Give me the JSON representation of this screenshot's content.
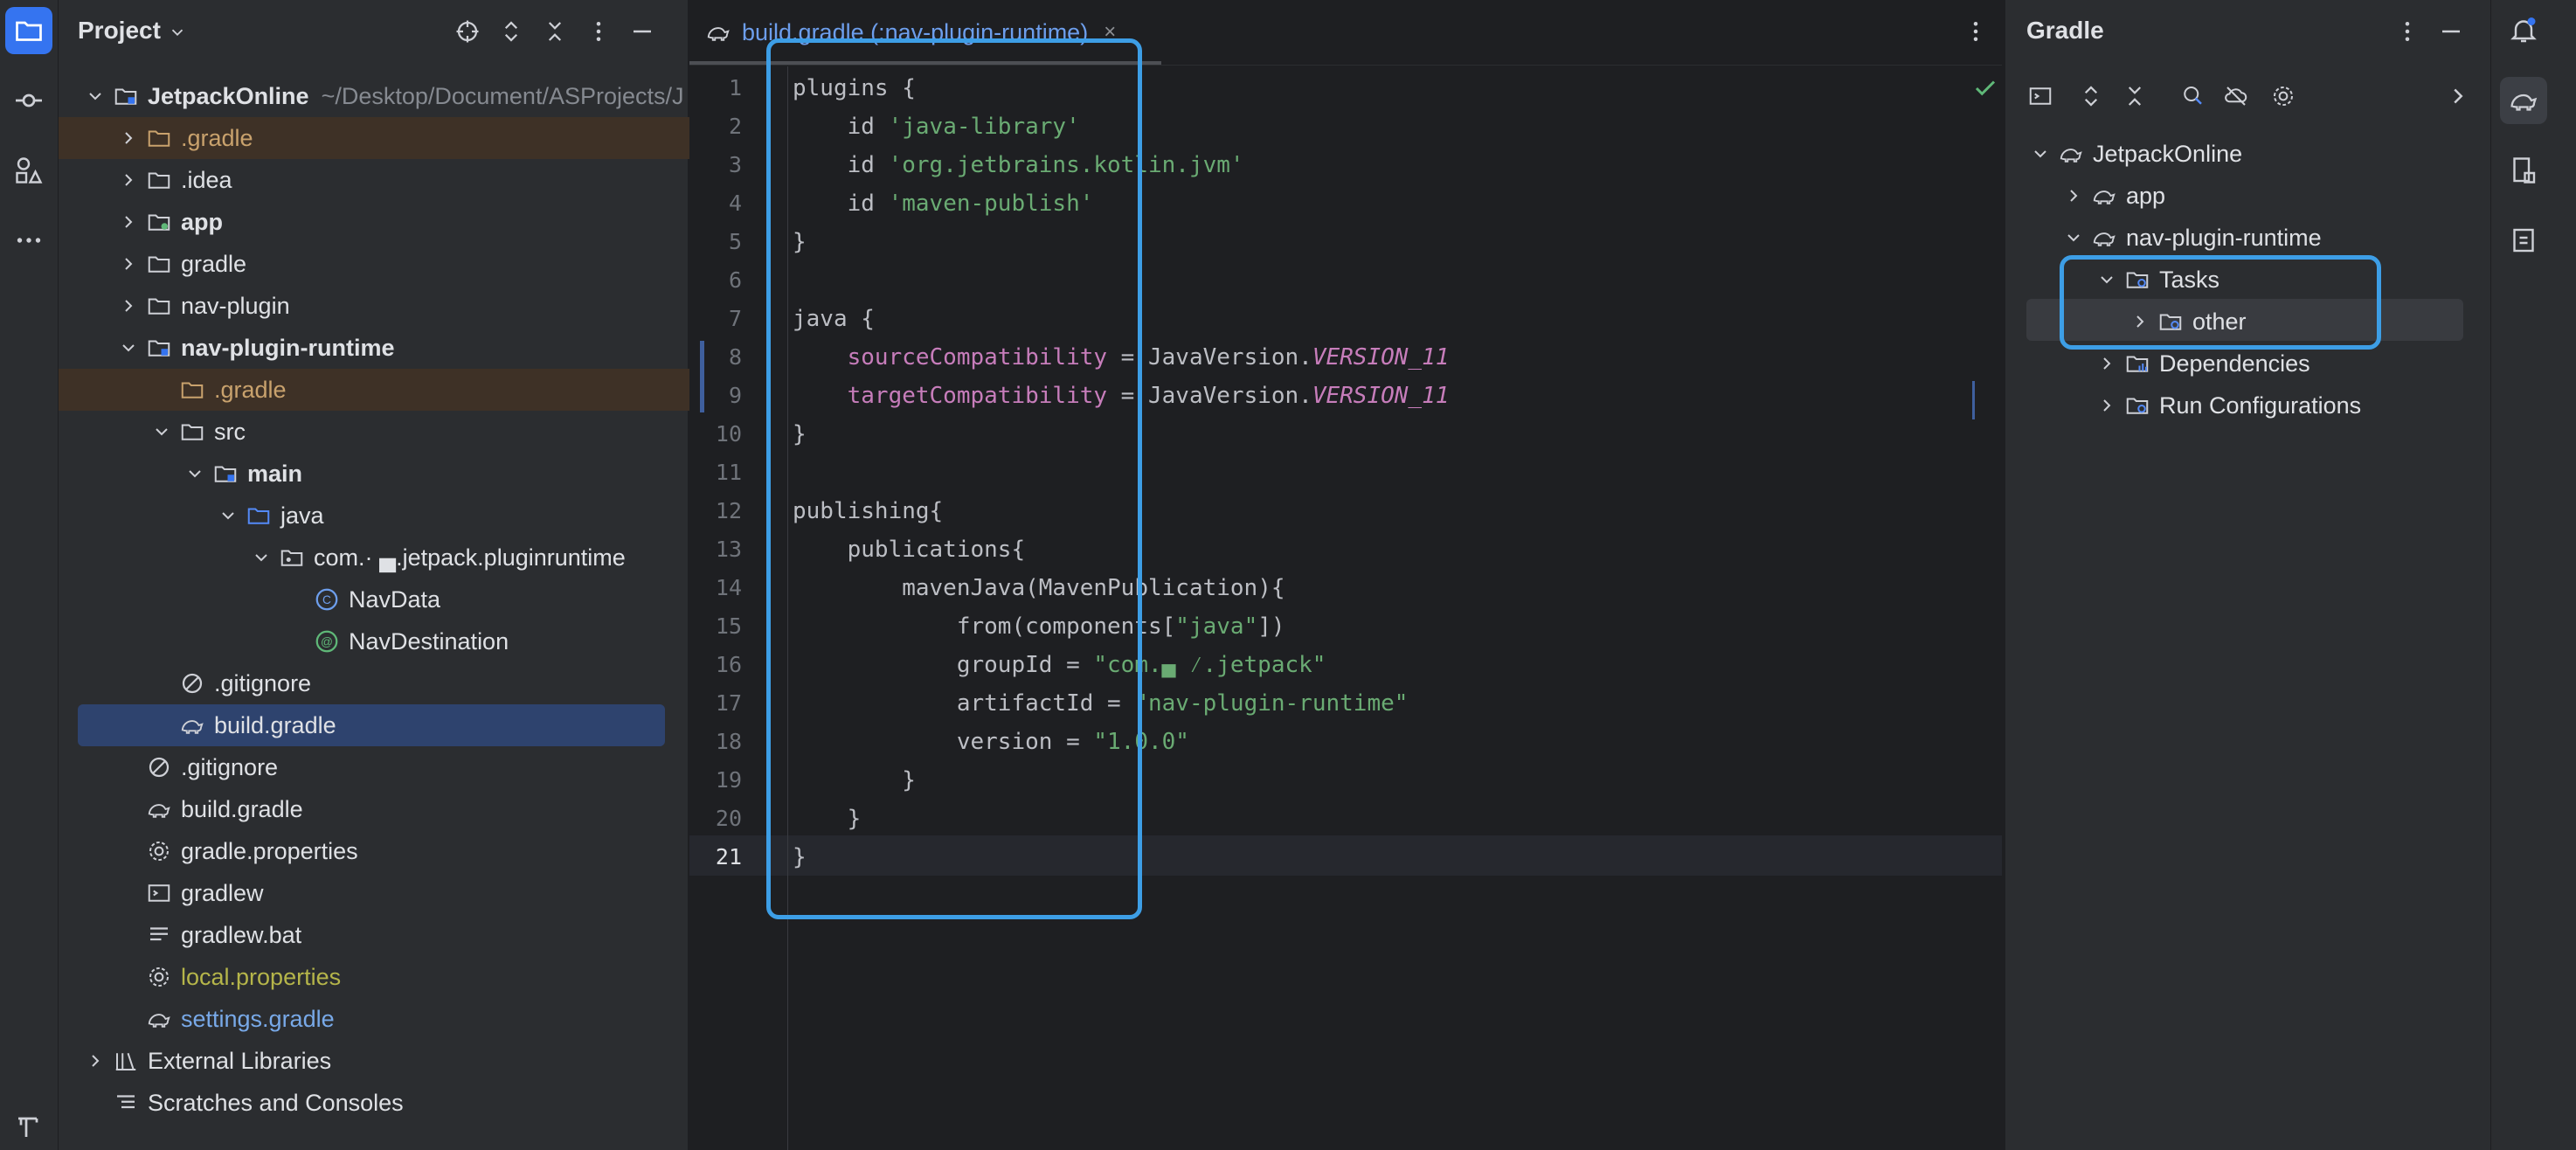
{
  "project_panel": {
    "title": "Project",
    "tree": [
      {
        "label": "JetpackOnline",
        "path": "~/Desktop/Document/ASProjects/J",
        "bold": true
      },
      {
        "label": ".gradle"
      },
      {
        "label": ".idea"
      },
      {
        "label": "app"
      },
      {
        "label": "gradle"
      },
      {
        "label": "nav-plugin"
      },
      {
        "label": "nav-plugin-runtime"
      },
      {
        "label": ".gradle"
      },
      {
        "label": "src"
      },
      {
        "label": "main"
      },
      {
        "label": "java"
      },
      {
        "label": "com.·  ▄.jetpack.pluginruntime"
      },
      {
        "label": "NavData"
      },
      {
        "label": "NavDestination"
      },
      {
        "label": ".gitignore"
      },
      {
        "label": "build.gradle"
      },
      {
        "label": ".gitignore"
      },
      {
        "label": "build.gradle"
      },
      {
        "label": "gradle.properties"
      },
      {
        "label": "gradlew"
      },
      {
        "label": "gradlew.bat"
      },
      {
        "label": "local.properties"
      },
      {
        "label": "settings.gradle"
      },
      {
        "label": "External Libraries"
      },
      {
        "label": "Scratches and Consoles"
      }
    ]
  },
  "editor": {
    "tab_label": "build.gradle (:nav-plugin-runtime)",
    "tab_close": "×",
    "line_numbers": [
      "1",
      "2",
      "3",
      "4",
      "5",
      "6",
      "7",
      "8",
      "9",
      "10",
      "11",
      "12",
      "13",
      "14",
      "15",
      "16",
      "17",
      "18",
      "19",
      "20",
      "21"
    ],
    "code": {
      "l1": "plugins {",
      "l2_kw": "    id ",
      "l2_str": "'java-library'",
      "l3_kw": "    id ",
      "l3_str": "'org.jetbrains.kotlin.jvm'",
      "l4_kw": "    id ",
      "l4_str": "'maven-publish'",
      "l5": "}",
      "l7": "java {",
      "l8_prop": "    sourceCompatibility",
      "l8_mid": " = JavaVersion.",
      "l8_const": "VERSION_11",
      "l9_prop": "    targetCompatibility",
      "l9_mid": " = JavaVersion.",
      "l9_const": "VERSION_11",
      "l10": "}",
      "l12": "publishing{",
      "l13": "    publications{",
      "l14": "        mavenJava(MavenPublication){",
      "l15_a": "            from(components[",
      "l15_str": "\"java\"",
      "l15_b": "])",
      "l16_a": "            groupId = ",
      "l16_str": "\"com.▄ ⁄.jetpack\"",
      "l17_a": "            artifactId = ",
      "l17_str": "\"nav-plugin-runtime\"",
      "l18_a": "            version = ",
      "l18_str": "\"1.0.0\"",
      "l19": "        }",
      "l20": "    }",
      "l21": "}"
    }
  },
  "gradle_panel": {
    "title": "Gradle",
    "tree": [
      {
        "label": "JetpackOnline"
      },
      {
        "label": "app"
      },
      {
        "label": "nav-plugin-runtime"
      },
      {
        "label": "Tasks"
      },
      {
        "label": "other"
      },
      {
        "label": "Dependencies"
      },
      {
        "label": "Run Configurations"
      }
    ]
  },
  "colors": {
    "accent_highlight": "#3d9ee6",
    "selection": "#2e436e",
    "string": "#6aab73",
    "property": "#c77dbb"
  }
}
